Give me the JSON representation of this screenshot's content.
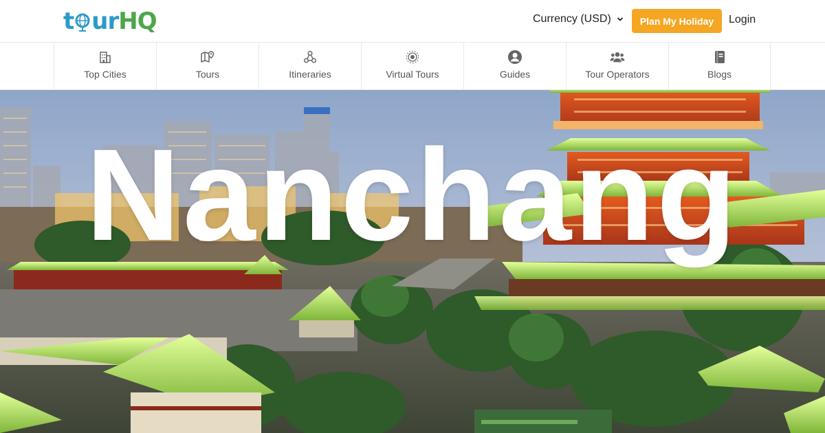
{
  "header": {
    "logo": {
      "part1": "t",
      "part2": "ur",
      "part3": "HQ"
    },
    "currency_label": "Currency (USD)",
    "plan_button": "Plan My Holiday",
    "login_label": "Login"
  },
  "nav": {
    "items": [
      {
        "label": "Top Cities",
        "icon": "city-icon"
      },
      {
        "label": "Tours",
        "icon": "map-pin-icon"
      },
      {
        "label": "Itineraries",
        "icon": "route-icon"
      },
      {
        "label": "Virtual Tours",
        "icon": "virtual-tour-icon"
      },
      {
        "label": "Guides",
        "icon": "user-circle-icon"
      },
      {
        "label": "Tour Operators",
        "icon": "users-icon"
      },
      {
        "label": "Blogs",
        "icon": "book-icon"
      }
    ]
  },
  "hero": {
    "title": "Nanchang"
  },
  "colors": {
    "accent": "#f5a623",
    "logo_blue": "#2c9ac9",
    "logo_green": "#4da64a",
    "text_dark": "#222222",
    "nav_text": "#555555"
  }
}
